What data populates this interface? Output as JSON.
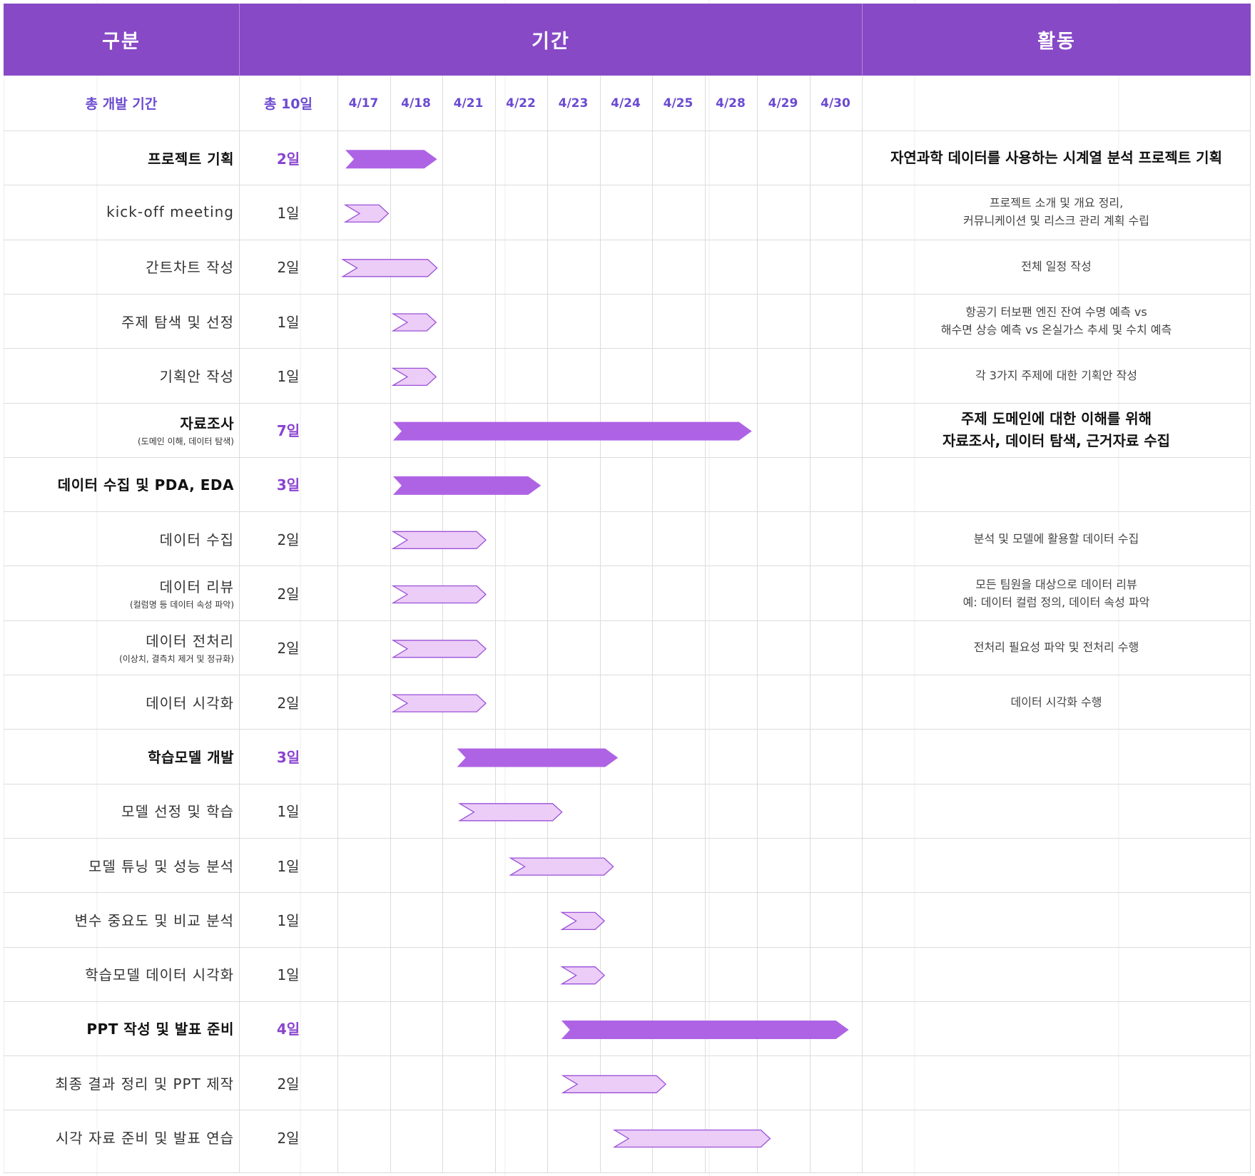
{
  "header": {
    "category": "구분",
    "period": "기간",
    "activity": "활동"
  },
  "summary": {
    "label": "총 개발 기간",
    "total": "총 10일"
  },
  "colors": {
    "header_bg": "#8849c6",
    "main_bar": "#ae63e4",
    "sub_bar_fill": "#ebcdf7",
    "sub_bar_stroke": "#9b50d8",
    "accent_text": "#6b4ad0",
    "main_duration_text": "#8a43cf",
    "grid": "#dcdcdc"
  },
  "chart_data": {
    "type": "gantt",
    "dates": [
      "4/17",
      "4/18",
      "4/21",
      "4/22",
      "4/23",
      "4/24",
      "4/25",
      "4/28",
      "4/29",
      "4/30"
    ],
    "tasks": [
      {
        "name": "프로젝트 기획",
        "sub": "",
        "duration": "2일",
        "main": true,
        "start": 0.15,
        "end": 1.9,
        "activity": [
          "자연과학 데이터를 사용하는 시계열 분석 프로젝트 기획"
        ]
      },
      {
        "name": "kick-off meeting",
        "sub": "",
        "duration": "1일",
        "main": false,
        "start": 0.15,
        "end": 0.97,
        "activity": [
          "프로젝트 소개 및 개요 정리,",
          "커뮤니케이션 및 리스크 관리 계획 수립"
        ]
      },
      {
        "name": "간트차트 작성",
        "sub": "",
        "duration": "2일",
        "main": false,
        "start": 0.1,
        "end": 1.9,
        "activity": [
          "전체 일정 작성"
        ]
      },
      {
        "name": "주제 탐색 및 선정",
        "sub": "",
        "duration": "1일",
        "main": false,
        "start": 1.06,
        "end": 1.88,
        "activity": [
          "항공기 터보팬 엔진 잔여 수명 예측 vs",
          "해수면 상승 예측 vs 온실가스 추세 및 수치 예측"
        ]
      },
      {
        "name": "기획안 작성",
        "sub": "",
        "duration": "1일",
        "main": false,
        "start": 1.06,
        "end": 1.88,
        "activity": [
          "각 3가지 주제에 대한 기획안 작성"
        ]
      },
      {
        "name": "자료조사",
        "sub": "(도메인 이해, 데이터 탐색)",
        "duration": "7일",
        "main": true,
        "start": 1.06,
        "end": 7.9,
        "activity": [
          "주제 도메인에 대한 이해를 위해",
          "자료조사, 데이터 탐색, 근거자료 수집"
        ]
      },
      {
        "name": "데이터 수집 및 PDA, EDA",
        "sub": "",
        "duration": "3일",
        "main": true,
        "start": 1.06,
        "end": 3.88,
        "activity": []
      },
      {
        "name": "데이터 수집",
        "sub": "",
        "duration": "2일",
        "main": false,
        "start": 1.06,
        "end": 2.83,
        "activity": [
          "분석 및 모델에 활용할 데이터 수집"
        ]
      },
      {
        "name": "데이터 리뷰",
        "sub": "(컬럼명 등 데이터 속성 파악)",
        "duration": "2일",
        "main": false,
        "start": 1.06,
        "end": 2.83,
        "activity": [
          "모든 팀원을 대상으로 데이터 리뷰",
          "예: 데이터 컬럼 정의, 데이터 속성 파악"
        ]
      },
      {
        "name": "데이터 전처리",
        "sub": "(이상치, 결측치 제거 및 정규화)",
        "duration": "2일",
        "main": false,
        "start": 1.06,
        "end": 2.83,
        "activity": [
          "전처리 필요성 파악 및 전처리 수행"
        ]
      },
      {
        "name": "데이터 시각화",
        "sub": "",
        "duration": "2일",
        "main": false,
        "start": 1.06,
        "end": 2.83,
        "activity": [
          "데이터 시각화 수행"
        ]
      },
      {
        "name": "학습모델 개발",
        "sub": "",
        "duration": "3일",
        "main": true,
        "start": 2.28,
        "end": 5.35,
        "activity": []
      },
      {
        "name": "모델 선정 및 학습",
        "sub": "",
        "duration": "1일",
        "main": false,
        "start": 2.33,
        "end": 4.28,
        "activity": []
      },
      {
        "name": "모델 튜닝 및 성능 분석",
        "sub": "",
        "duration": "1일",
        "main": false,
        "start": 3.3,
        "end": 5.26,
        "activity": []
      },
      {
        "name": "변수 중요도 및 비교 분석",
        "sub": "",
        "duration": "1일",
        "main": false,
        "start": 4.28,
        "end": 5.09,
        "activity": []
      },
      {
        "name": "학습모델 데이터 시각화",
        "sub": "",
        "duration": "1일",
        "main": false,
        "start": 4.28,
        "end": 5.09,
        "activity": []
      },
      {
        "name": "PPT 작성 및 발표 준비",
        "sub": "",
        "duration": "4일",
        "main": true,
        "start": 4.27,
        "end": 9.75,
        "activity": []
      },
      {
        "name": "최종 결과 정리 및 PPT 제작",
        "sub": "",
        "duration": "2일",
        "main": false,
        "start": 4.3,
        "end": 6.26,
        "activity": []
      },
      {
        "name": "시각 자료 준비 및 발표 연습",
        "sub": "",
        "duration": "2일",
        "main": false,
        "start": 5.28,
        "end": 8.25,
        "activity": []
      }
    ]
  }
}
